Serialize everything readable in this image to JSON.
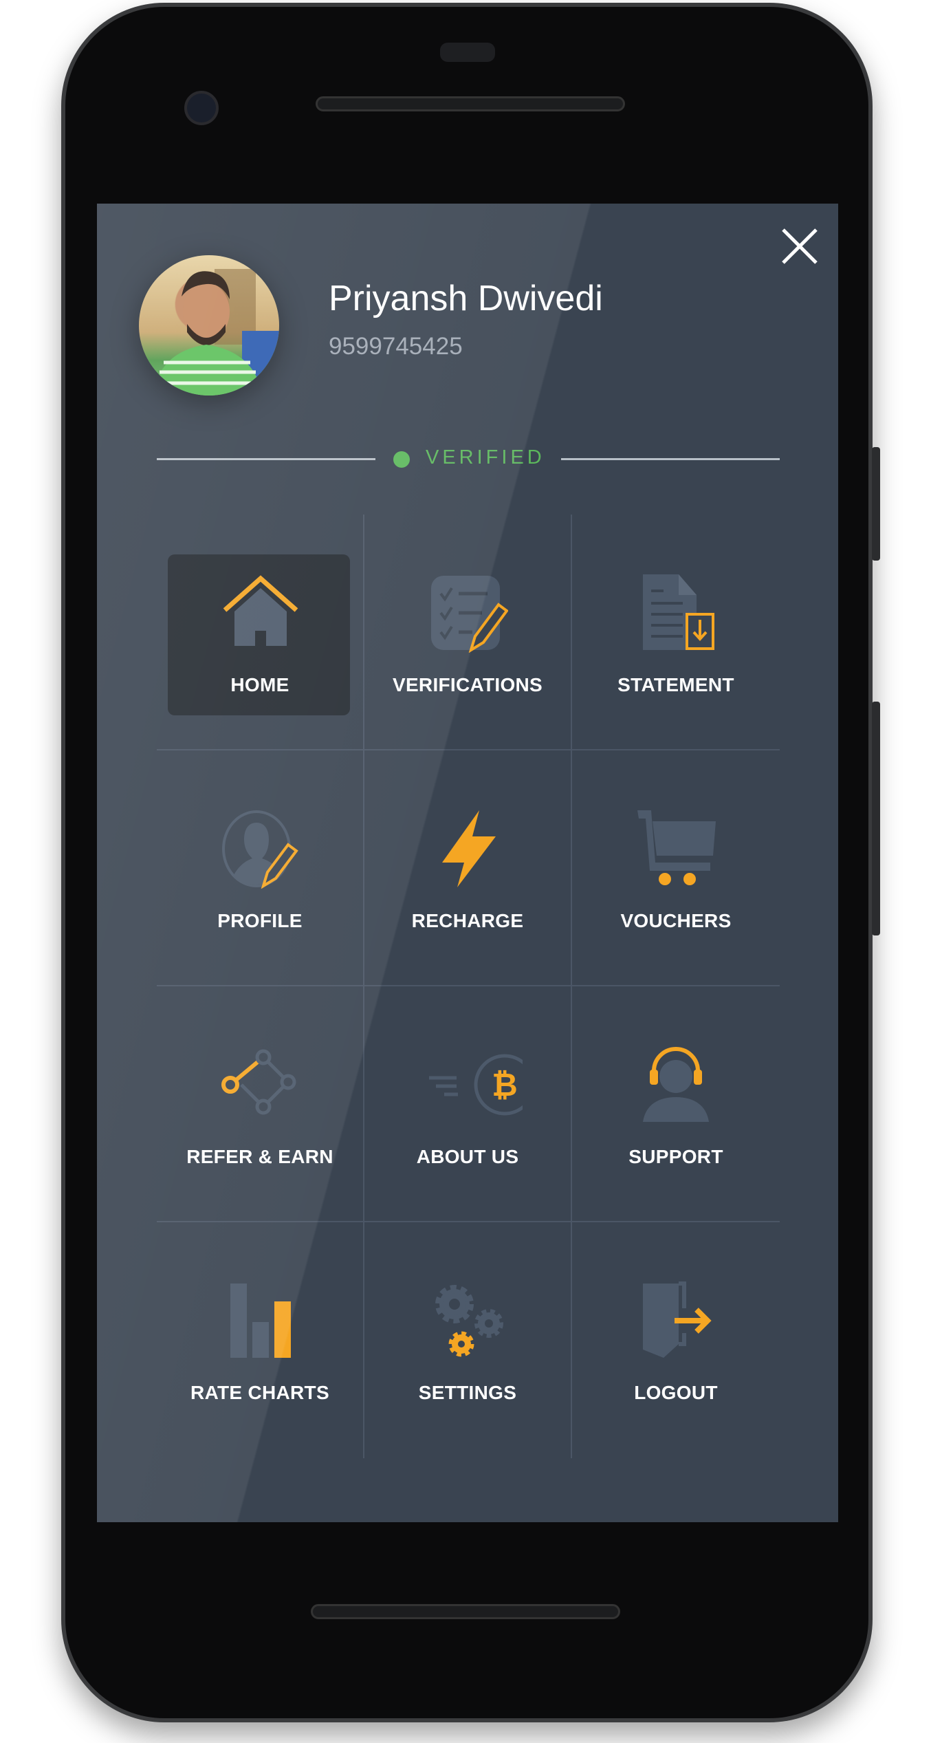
{
  "user": {
    "name": "Priyansh Dwivedi",
    "phone": "9599745425",
    "status": "VERIFIED"
  },
  "menu": [
    {
      "label": "HOME",
      "icon": "home-icon",
      "active": true
    },
    {
      "label": "VERIFICATIONS",
      "icon": "checklist-pencil-icon"
    },
    {
      "label": "STATEMENT",
      "icon": "document-download-icon"
    },
    {
      "label": "PROFILE",
      "icon": "profile-edit-icon"
    },
    {
      "label": "RECHARGE",
      "icon": "lightning-icon"
    },
    {
      "label": "VOUCHERS",
      "icon": "cart-icon"
    },
    {
      "label": "REFER & EARN",
      "icon": "share-nodes-icon"
    },
    {
      "label": "ABOUT US",
      "icon": "bitcoin-icon"
    },
    {
      "label": "SUPPORT",
      "icon": "headset-icon"
    },
    {
      "label": "RATE CHARTS",
      "icon": "bar-chart-icon"
    },
    {
      "label": "SETTINGS",
      "icon": "gears-icon"
    },
    {
      "label": "LOGOUT",
      "icon": "logout-door-icon"
    }
  ],
  "colors": {
    "background": "#3a4451",
    "accent": "#f5a623",
    "verified": "#5cb85c",
    "active_tile": "#242a31",
    "icon_gray": "#4d5a6b"
  }
}
